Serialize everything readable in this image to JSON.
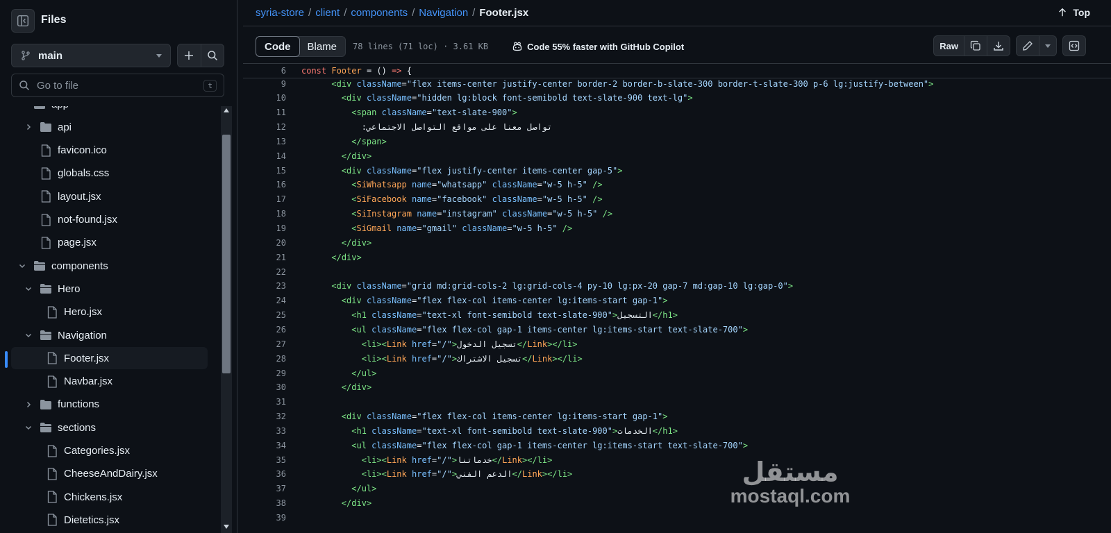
{
  "sidebar": {
    "title": "Files",
    "branch": "main",
    "search_placeholder": "Go to file",
    "search_shortcut": "t",
    "tree": [
      {
        "label": "app",
        "kind": "folder-open",
        "depth": 0,
        "expanded": true
      },
      {
        "label": "api",
        "kind": "folder",
        "depth": 1,
        "expanded": false
      },
      {
        "label": "favicon.ico",
        "kind": "file",
        "depth": 1
      },
      {
        "label": "globals.css",
        "kind": "file",
        "depth": 1
      },
      {
        "label": "layout.jsx",
        "kind": "file",
        "depth": 1
      },
      {
        "label": "not-found.jsx",
        "kind": "file",
        "depth": 1
      },
      {
        "label": "page.jsx",
        "kind": "file",
        "depth": 1
      },
      {
        "label": "components",
        "kind": "folder-open",
        "depth": 0,
        "expanded": true
      },
      {
        "label": "Hero",
        "kind": "folder-open",
        "depth": 1,
        "expanded": true
      },
      {
        "label": "Hero.jsx",
        "kind": "file",
        "depth": 2
      },
      {
        "label": "Navigation",
        "kind": "folder-open",
        "depth": 1,
        "expanded": true
      },
      {
        "label": "Footer.jsx",
        "kind": "file",
        "depth": 2,
        "active": true
      },
      {
        "label": "Navbar.jsx",
        "kind": "file",
        "depth": 2
      },
      {
        "label": "functions",
        "kind": "folder",
        "depth": 1,
        "expanded": false
      },
      {
        "label": "sections",
        "kind": "folder-open",
        "depth": 1,
        "expanded": true
      },
      {
        "label": "Categories.jsx",
        "kind": "file",
        "depth": 2
      },
      {
        "label": "CheeseAndDairy.jsx",
        "kind": "file",
        "depth": 2
      },
      {
        "label": "Chickens.jsx",
        "kind": "file",
        "depth": 2
      },
      {
        "label": "Dietetics.jsx",
        "kind": "file",
        "depth": 2
      }
    ]
  },
  "breadcrumb": {
    "parts": [
      "syria-store",
      "client",
      "components",
      "Navigation"
    ],
    "current": "Footer.jsx",
    "top_label": "Top"
  },
  "file_header": {
    "tab_code": "Code",
    "tab_blame": "Blame",
    "meta": "78 lines (71 loc) · 3.61 KB",
    "copilot": "Code 55% faster with GitHub Copilot",
    "raw": "Raw"
  },
  "code": {
    "sticky": {
      "num": 6,
      "text": "const Footer = () => {"
    },
    "lines": [
      {
        "num": 9,
        "text": "      <div className=\"flex items-center justify-center border-2 border-b-slate-300 border-t-slate-300 p-6 lg:justify-between\">"
      },
      {
        "num": 10,
        "text": "        <div className=\"hidden lg:block font-semibold text-slate-900 text-lg\">"
      },
      {
        "num": 11,
        "text": "          <span className=\"text-slate-900\">"
      },
      {
        "num": 12,
        "text": "            :تواصل معنا على مواقع التواصل الاجتماعي"
      },
      {
        "num": 13,
        "text": "          </span>"
      },
      {
        "num": 14,
        "text": "        </div>"
      },
      {
        "num": 15,
        "text": "        <div className=\"flex justify-center items-center gap-5\">"
      },
      {
        "num": 16,
        "text": "          <SiWhatsapp name=\"whatsapp\" className=\"w-5 h-5\" />"
      },
      {
        "num": 17,
        "text": "          <SiFacebook name=\"facebook\" className=\"w-5 h-5\" />"
      },
      {
        "num": 18,
        "text": "          <SiInstagram name=\"instagram\" className=\"w-5 h-5\" />"
      },
      {
        "num": 19,
        "text": "          <SiGmail name=\"gmail\" className=\"w-5 h-5\" />"
      },
      {
        "num": 20,
        "text": "        </div>"
      },
      {
        "num": 21,
        "text": "      </div>"
      },
      {
        "num": 22,
        "text": ""
      },
      {
        "num": 23,
        "text": "      <div className=\"grid md:grid-cols-2 lg:grid-cols-4 py-10 lg:px-20 gap-7 md:gap-10 lg:gap-0\">"
      },
      {
        "num": 24,
        "text": "        <div className=\"flex flex-col items-center lg:items-start gap-1\">"
      },
      {
        "num": 25,
        "text": "          <h1 className=\"text-xl font-semibold text-slate-900\">التسجيل</h1>"
      },
      {
        "num": 26,
        "text": "          <ul className=\"flex flex-col gap-1 items-center lg:items-start text-slate-700\">"
      },
      {
        "num": 27,
        "text": "            <li><Link href=\"/\">تسجيل الدخول</Link></li>"
      },
      {
        "num": 28,
        "text": "            <li><Link href=\"/\">تسجيل الاشتراك</Link></li>"
      },
      {
        "num": 29,
        "text": "          </ul>"
      },
      {
        "num": 30,
        "text": "        </div>"
      },
      {
        "num": 31,
        "text": ""
      },
      {
        "num": 32,
        "text": "        <div className=\"flex flex-col items-center lg:items-start gap-1\">"
      },
      {
        "num": 33,
        "text": "          <h1 className=\"text-xl font-semibold text-slate-900\">الخدمات</h1>"
      },
      {
        "num": 34,
        "text": "          <ul className=\"flex flex-col gap-1 items-center lg:items-start text-slate-700\">"
      },
      {
        "num": 35,
        "text": "            <li><Link href=\"/\">خدماتنا</Link></li>"
      },
      {
        "num": 36,
        "text": "            <li><Link href=\"/\">الدعم الفني</Link></li>"
      },
      {
        "num": 37,
        "text": "          </ul>"
      },
      {
        "num": 38,
        "text": "        </div>"
      },
      {
        "num": 39,
        "text": ""
      }
    ]
  },
  "watermark": {
    "arabic": "مستقل",
    "latin": "mostaql.com"
  },
  "colors": {
    "background": "#0d1117",
    "border": "#30363d",
    "link": "#4493f8",
    "tag": "#7ee787",
    "attr": "#79c0ff",
    "string": "#a5d6ff",
    "keyword": "#ff7b72",
    "component": "#ffa657"
  }
}
